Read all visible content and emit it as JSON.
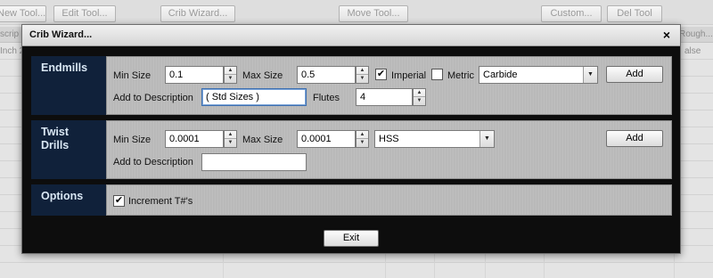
{
  "background": {
    "toolbar": [
      "New Tool...",
      "Edit Tool...",
      "Crib Wizard...",
      "Move Tool...",
      "Custom...",
      "Del Tool"
    ],
    "header_fragments": [
      "scrip",
      "Rough..."
    ],
    "row_fragments": [
      "Inch 2",
      "alse"
    ]
  },
  "dialog": {
    "title": "Crib Wizard...",
    "close_glyph": "×"
  },
  "endmills": {
    "label": "Endmills",
    "min_size_label": "Min Size",
    "min_size": "0.1",
    "max_size_label": "Max Size",
    "max_size": "0.5",
    "imperial_label": "Imperial",
    "imperial_checked": true,
    "metric_label": "Metric",
    "metric_checked": false,
    "material": "Carbide",
    "add_label": "Add",
    "desc_label": "Add to Description",
    "desc_value": "( Std Sizes )",
    "flutes_label": "Flutes",
    "flutes": "4"
  },
  "drills": {
    "label_line1": "Twist",
    "label_line2": "Drills",
    "min_size_label": "Min Size",
    "min_size": "0.0001",
    "max_size_label": "Max Size",
    "max_size": "0.0001",
    "material": "HSS",
    "add_label": "Add",
    "desc_label": "Add to Description",
    "desc_value": ""
  },
  "options": {
    "label": "Options",
    "increment_label": "Increment T#'s",
    "increment_checked": true
  },
  "footer": {
    "exit_label": "Exit"
  },
  "glyphs": {
    "check": "✔",
    "spin_up": "▲",
    "spin_down": "▼",
    "dropdown": "▼"
  }
}
